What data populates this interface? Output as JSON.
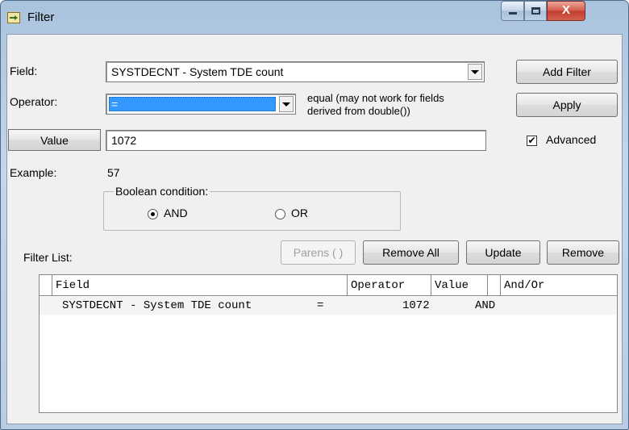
{
  "window": {
    "title": "Filter",
    "close_glyph": "X"
  },
  "field": {
    "label": "Field:",
    "value": "SYSTDECNT - System TDE count"
  },
  "operator": {
    "label": "Operator:",
    "value": "=",
    "hint_line1": "equal (may not work for fields",
    "hint_line2": "derived from double())"
  },
  "value": {
    "button_label": "Value",
    "input_value": "1072"
  },
  "example": {
    "label": "Example:",
    "value": "57"
  },
  "boolean": {
    "legend": "Boolean condition:",
    "and_label": "AND",
    "or_label": "OR",
    "selected": "AND"
  },
  "buttons": {
    "add_filter": "Add Filter",
    "apply": "Apply",
    "advanced": "Advanced",
    "advanced_checked": true,
    "parens": "Parens ( )",
    "remove_all": "Remove All",
    "update": "Update",
    "remove": "Remove"
  },
  "filter_list": {
    "label": "Filter List:",
    "columns": [
      "Field",
      "Operator",
      "Value",
      "And/Or"
    ],
    "rows": [
      {
        "field": "SYSTDECNT - System TDE count",
        "operator": "=",
        "value": "1072",
        "and_or": "AND"
      }
    ]
  },
  "colors": {
    "selection": "#3399ff",
    "title_bar": "#b8cce3",
    "close_button": "#c94737"
  }
}
